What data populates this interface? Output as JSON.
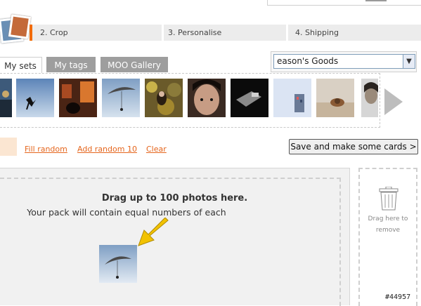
{
  "steps": [
    {
      "label": "2. Crop"
    },
    {
      "label": "3. Personalise"
    },
    {
      "label": "4. Shipping"
    }
  ],
  "tabs": [
    {
      "label": "My sets",
      "active": true
    },
    {
      "label": "My tags",
      "active": false
    },
    {
      "label": "MOO Gallery",
      "active": false
    }
  ],
  "set_select": {
    "value": "eason's Goods",
    "arrow": "▼"
  },
  "actions": {
    "fill_random": "Fill random",
    "add_random": "Add random 10",
    "clear": "Clear",
    "save": "Save and make some cards >"
  },
  "drop_zone": {
    "title": "Drag up to 100 photos here.",
    "subtitle": "Your pack will contain equal numbers of each"
  },
  "trash": {
    "line1": "Drag here to",
    "line2": "remove"
  },
  "watermark": "#44957",
  "colors": {
    "accent": "#f26b00",
    "link": "#e5651c",
    "arrow": "#f2c200"
  }
}
